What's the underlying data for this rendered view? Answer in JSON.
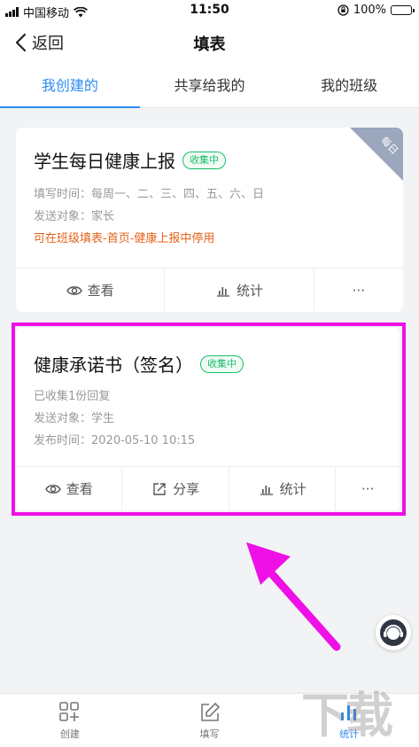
{
  "status_bar": {
    "carrier": "中国移动",
    "time": "11:50",
    "battery": "100%"
  },
  "nav": {
    "back_label": "返回",
    "title": "填表"
  },
  "tabs": [
    {
      "label": "我创建的",
      "active": true
    },
    {
      "label": "共享给我的",
      "active": false
    },
    {
      "label": "我的班级",
      "active": false
    }
  ],
  "cards": [
    {
      "title": "学生每日健康上报",
      "badge": "收集中",
      "ribbon": "每日",
      "lines": [
        "填写时间：每周一、二、三、四、五、六、日",
        "发送对象：家长"
      ],
      "warning": "可在班级填表-首页-健康上报中停用",
      "actions": [
        "查看",
        "统计",
        "···"
      ]
    },
    {
      "title": "健康承诺书（签名）",
      "badge": "收集中",
      "lines": [
        "已收集1份回复",
        "发送对象：学生",
        "发布时间：2020-05-10 10:15"
      ],
      "actions": [
        "查看",
        "分享",
        "统计",
        "···"
      ]
    }
  ],
  "bottom_tabs": [
    {
      "label": "创建",
      "icon": "grid-plus-icon"
    },
    {
      "label": "填写",
      "icon": "edit-icon"
    },
    {
      "label": "统计",
      "icon": "stats-icon",
      "active": true
    }
  ],
  "watermark": "下载吧",
  "colors": {
    "accent": "#2d8cf0",
    "badge_green": "#19be6b",
    "warning": "#e6621a",
    "highlight": "#ee10e6"
  }
}
